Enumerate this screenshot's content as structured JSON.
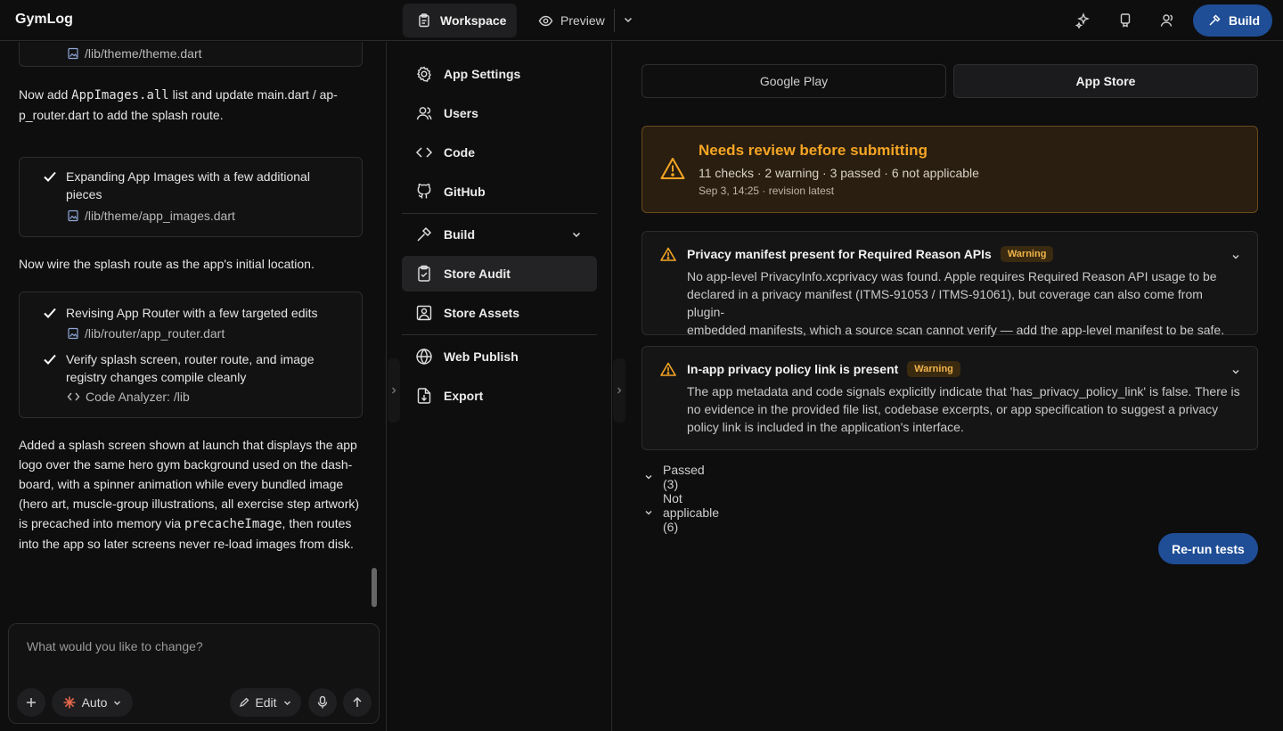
{
  "app": {
    "title": "GymLog"
  },
  "topbar": {
    "workspace_label": "Workspace",
    "preview_label": "Preview",
    "build_label": "Build"
  },
  "chat": {
    "card1": {
      "path": "/lib/theme/theme.dart"
    },
    "para1": {
      "prefix": "Now add ",
      "code": "AppImages.all",
      "suffix": " list and update main.dart / ap-",
      "line2": "p_router.dart to add the splash route."
    },
    "card2": {
      "title_line1": "Expanding App Images with a few additional",
      "title_line2": "pieces",
      "path": "/lib/theme/app_images.dart"
    },
    "para2": "Now wire the splash route as the app's initial location.",
    "card3": {
      "item1": "Revising App Router with a few targeted edits",
      "item1_path": "/lib/router/app_router.dart",
      "item2_line1": "Verify splash screen, router route, and image",
      "item2_line2": "registry changes compile cleanly",
      "item2_tool": "Code Analyzer: /lib"
    },
    "para3": {
      "l1": "Added a splash screen shown at launch that displays the app",
      "l2": "logo over the same hero gym background used on the dash-",
      "l3": "board, with a spinner animation while every bundled image",
      "l4": "(hero art, muscle-group illustrations, all exercise step artwork)",
      "l5_prefix": "is precached into memory via ",
      "l5_code": "precacheImage",
      "l5_suffix": ", then routes",
      "l6": "into the app so later screens never re-load images from disk."
    },
    "composer": {
      "placeholder": "What would you like to change?",
      "mode_label": "Auto",
      "edit_label": "Edit"
    }
  },
  "nav": {
    "items": [
      {
        "label": "App Settings"
      },
      {
        "label": "Users"
      },
      {
        "label": "Code"
      },
      {
        "label": "GitHub"
      },
      {
        "label": "Build"
      },
      {
        "label": "Store Audit"
      },
      {
        "label": "Store Assets"
      },
      {
        "label": "Web Publish"
      },
      {
        "label": "Export"
      }
    ]
  },
  "audit": {
    "stores": {
      "google": "Google Play",
      "apple": "App Store"
    },
    "summary": {
      "title": "Needs review before submitting",
      "counts": "11 checks · 2 warning · 3 passed · 6 not applicable",
      "meta": "Sep 3, 14:25 · revision latest"
    },
    "issues": [
      {
        "title": "Privacy manifest present for Required Reason APIs",
        "badge": "Warning",
        "body_l1": "No app-level PrivacyInfo.xcprivacy was found. Apple requires Required Reason API usage to be",
        "body_l2": "declared in a privacy manifest (ITMS-91053 / ITMS-91061), but coverage can also come from plugin-",
        "body_l3": "embedded manifests, which a source scan cannot verify — add the app-level manifest to be safe."
      },
      {
        "title": "In-app privacy policy link is present",
        "badge": "Warning",
        "body_l1": "The app metadata and code signals explicitly indicate that 'has_privacy_policy_link' is false. There is",
        "body_l2": "no evidence in the provided file list, codebase excerpts, or app specification to suggest a privacy",
        "body_l3": "policy link is included in the application's interface."
      }
    ],
    "passed_label": "Passed (3)",
    "na_label": "Not applicable (6)",
    "rerun_label": "Re-run tests"
  },
  "colors": {
    "accent": "#1f4e96",
    "warning": "#f5a524",
    "background": "#0e0e0f"
  }
}
